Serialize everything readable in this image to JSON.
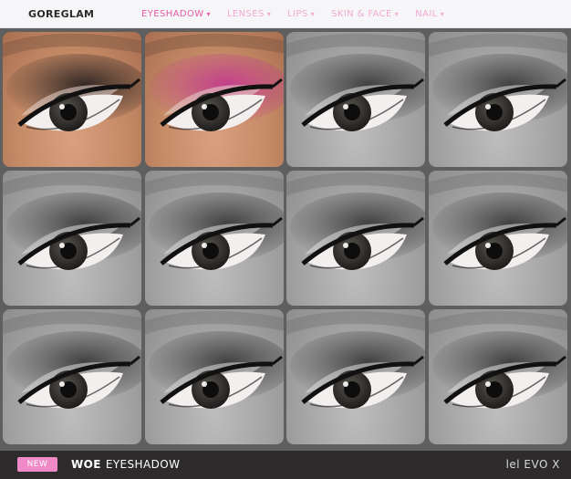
{
  "header": {
    "brand": "GOREGLAM",
    "nav": [
      {
        "label": "EYESHADOW",
        "active": true
      },
      {
        "label": "LENSES",
        "active": false
      },
      {
        "label": "LIPS",
        "active": false
      },
      {
        "label": "SKIN & FACE",
        "active": false
      },
      {
        "label": "NAIL",
        "active": false
      }
    ],
    "chevron_icon": "chevron-down-icon",
    "colors": {
      "active": "#e35aa6",
      "inactive": "#f2a9d2"
    }
  },
  "swatches": [
    {
      "variant": "skin",
      "shadow_color": "#2a2220"
    },
    {
      "variant": "skin",
      "shadow_color": "#c23a8c"
    },
    {
      "variant": "gray",
      "shadow_color": "#3a3a3a"
    },
    {
      "variant": "gray",
      "shadow_color": "#3a3a3a"
    },
    {
      "variant": "gray",
      "shadow_color": "#3a3a3a"
    },
    {
      "variant": "gray",
      "shadow_color": "#3a3a3a"
    },
    {
      "variant": "gray",
      "shadow_color": "#3a3a3a"
    },
    {
      "variant": "gray",
      "shadow_color": "#3a3a3a"
    },
    {
      "variant": "gray",
      "shadow_color": "#3a3a3a"
    },
    {
      "variant": "gray",
      "shadow_color": "#3a3a3a"
    },
    {
      "variant": "gray",
      "shadow_color": "#3a3a3a"
    },
    {
      "variant": "gray",
      "shadow_color": "#3a3a3a"
    }
  ],
  "footer": {
    "badge": "NEW",
    "product_name": "WOE",
    "product_type": "EYESHADOW",
    "compatibility": "lel EVO X",
    "badge_color": "#f08ac7"
  }
}
